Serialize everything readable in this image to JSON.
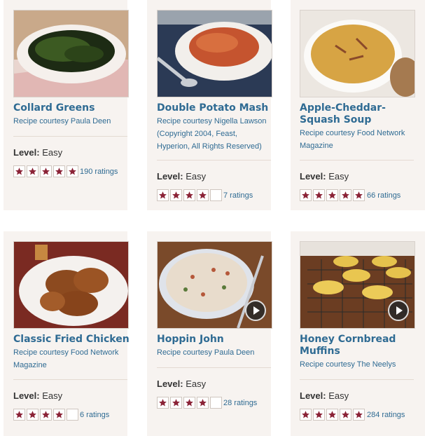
{
  "recipes": [
    {
      "title": "Collard Greens",
      "courtesy": "Recipe courtesy Paula Deen",
      "level_label": "Level:",
      "level": "Easy",
      "rating": 5,
      "ratings": "190 ratings",
      "image": "collard-greens-photo",
      "video": false
    },
    {
      "title": "Double Potato Mash",
      "courtesy": "Recipe courtesy Nigella Lawson (Copyright 2004, Feast, Hyperion, All Rights Reserved)",
      "level_label": "Level:",
      "level": "Easy",
      "rating": 4,
      "ratings": "7 ratings",
      "image": "potato-mash-photo",
      "video": false
    },
    {
      "title": "Apple-Cheddar-Squash Soup",
      "courtesy": "Recipe courtesy Food Network Magazine",
      "level_label": "Level:",
      "level": "Easy",
      "rating": 5,
      "ratings": "66 ratings",
      "image": "squash-soup-photo",
      "video": false
    },
    {
      "title": "Classic Fried Chicken",
      "courtesy": "Recipe courtesy Food Network Magazine",
      "level_label": "Level:",
      "level": "Easy",
      "rating": 4,
      "ratings": "6 ratings",
      "image": "fried-chicken-photo",
      "video": false
    },
    {
      "title": "Hoppin John",
      "courtesy": "Recipe courtesy Paula Deen",
      "level_label": "Level:",
      "level": "Easy",
      "rating": 4,
      "ratings": "28 ratings",
      "image": "hoppin-john-photo",
      "video": true
    },
    {
      "title": "Honey Cornbread Muffins",
      "courtesy": "Recipe courtesy The Neelys",
      "level_label": "Level:",
      "level": "Easy",
      "rating": 5,
      "ratings": "284 ratings",
      "image": "cornbread-muffins-photo",
      "video": true
    }
  ],
  "colors": {
    "link": "#2f6b93",
    "star": "#8b2337",
    "card_bg": "#f7f3f0"
  }
}
